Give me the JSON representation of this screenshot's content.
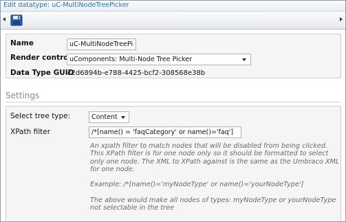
{
  "window": {
    "title": "Edit datatype: uC-MultiNodeTreePicker"
  },
  "toolbar": {
    "save_icon": "floppy-disk-save-icon"
  },
  "general": {
    "name_label": "Name",
    "name_value": "uC-MultiNodeTreePicker",
    "render_control_label": "Render control",
    "render_control_value": "uComponents: Multi-Node Tree Picker",
    "guid_label": "Data Type GUID",
    "guid_value": "c2d6894b-e788-4425-bcf2-308568e38b"
  },
  "settings": {
    "heading": "Settings",
    "tree_type_label": "Select tree type:",
    "tree_type_value": "Content",
    "xpath_label": "XPath filter",
    "xpath_value": "/*[name() = 'faqCategory' or name()='faq']",
    "description": [
      "An xpath filter to match nodes that will be disabled from being clicked.",
      "This XPath filter is for one node only so it should be formatted to select",
      "only one node. The XML to XPath against is the same as the Umbraco XML",
      "for one node.",
      "",
      "Example: /*[name()='myNodeType' or name()='yourNodeType']",
      "",
      "The above would make all nodes of types: myNodeType or yourNodeType",
      "not selectable in the tree"
    ]
  },
  "colors": {
    "accent": "#2f6fa6",
    "panel": "#f5f5f5",
    "border": "#cfcfcf"
  }
}
